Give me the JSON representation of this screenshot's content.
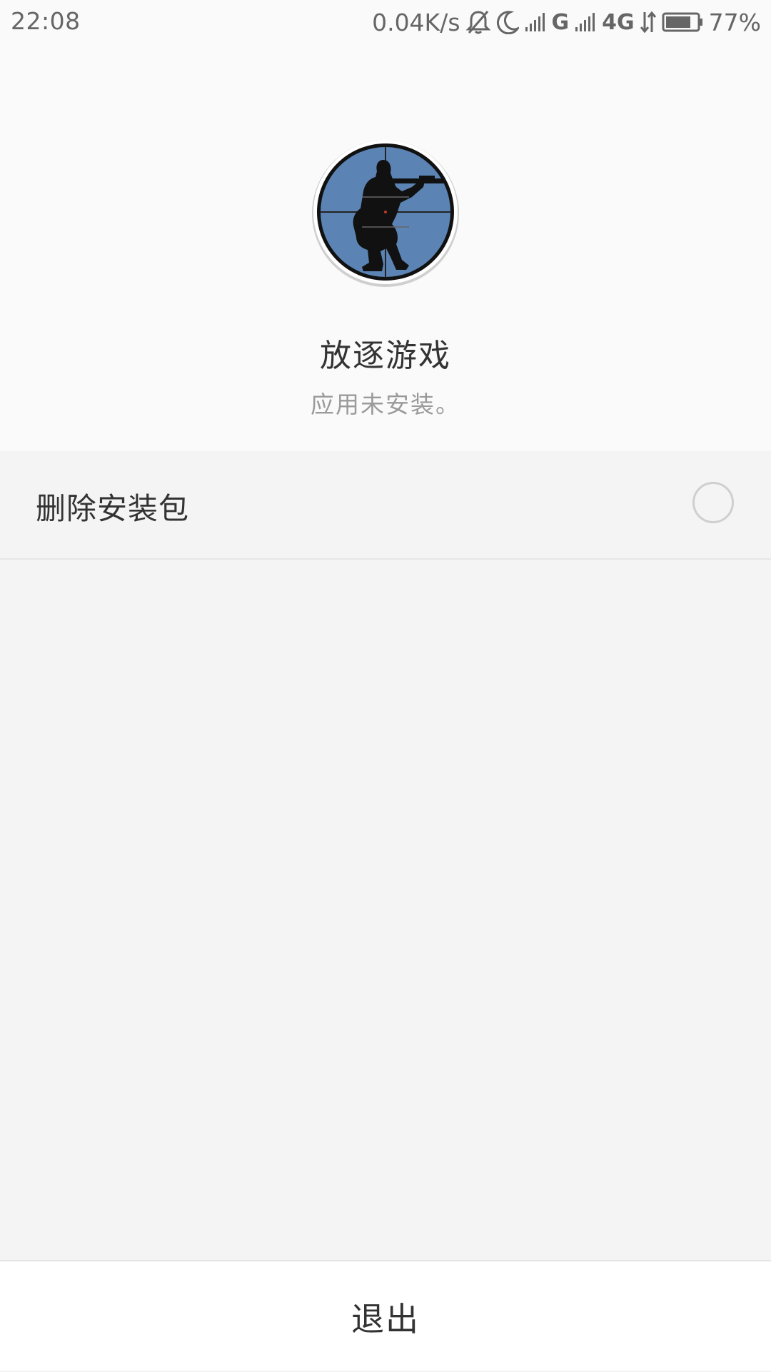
{
  "status_bar": {
    "time": "22:08",
    "network_speed": "0.04K/s",
    "sim1_type": "G",
    "sim2_type": "4G",
    "battery_percent": "77%",
    "icons": [
      "mute-bell-icon",
      "moon-icon",
      "signal-icon",
      "signal-icon",
      "data-arrows-icon",
      "battery-icon"
    ]
  },
  "app": {
    "name": "放逐游戏",
    "status": "应用未安装。",
    "icon": "sniper-scope-icon",
    "icon_colors": {
      "scope_fill": "#5b84b5",
      "ring": "#ffffff",
      "silhouette": "#111111"
    }
  },
  "options": {
    "delete_package_label": "删除安装包",
    "delete_package_checked": false
  },
  "footer": {
    "exit_label": "退出"
  }
}
